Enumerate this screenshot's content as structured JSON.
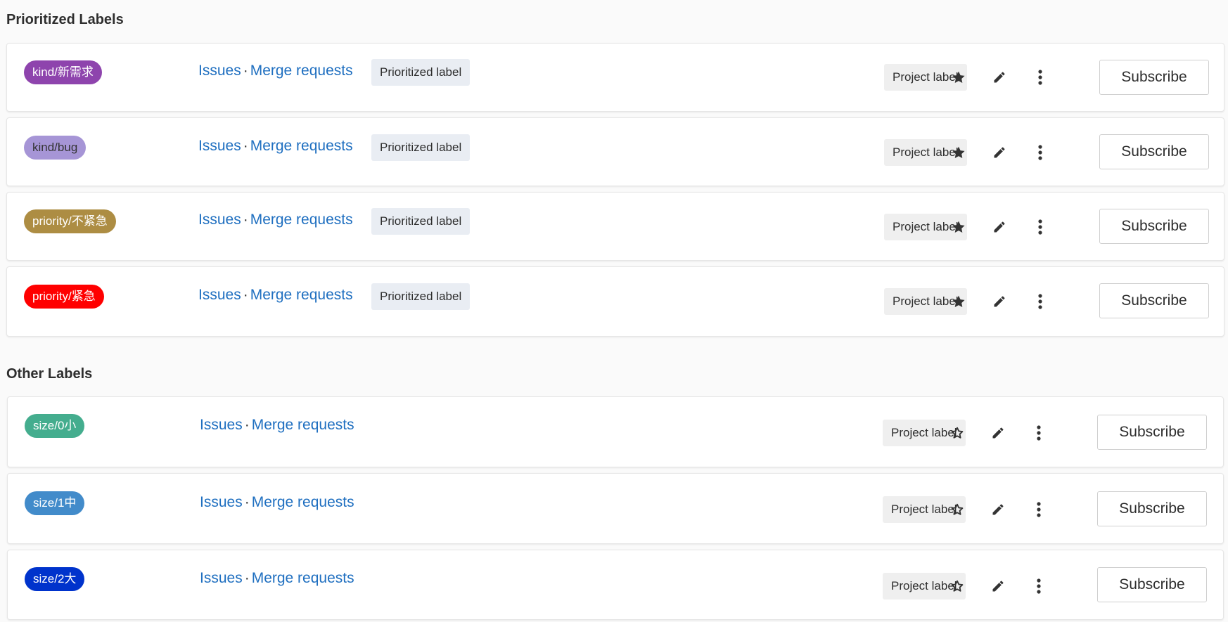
{
  "sections": {
    "prioritized_title": "Prioritized Labels",
    "other_title": "Other Labels"
  },
  "common": {
    "issues_link": "Issues",
    "separator": "·",
    "merge_requests_link": "Merge requests",
    "prioritized_badge": "Prioritized label",
    "project_badge": "Project label",
    "subscribe_label": "Subscribe"
  },
  "prioritized_labels": [
    {
      "name": "kind/新需求",
      "bg": "#8e44ad",
      "fg": "#ffffff",
      "starred": true
    },
    {
      "name": "kind/bug",
      "bg": "#a695d6",
      "fg": "#333333",
      "starred": true
    },
    {
      "name": "priority/不紧急",
      "bg": "#ad8d43",
      "fg": "#ffffff",
      "starred": true
    },
    {
      "name": "priority/紧急",
      "bg": "#ff0000",
      "fg": "#ffffff",
      "starred": true
    }
  ],
  "other_labels": [
    {
      "name": "size/0小",
      "bg": "#44ad8e",
      "fg": "#ffffff",
      "starred": false
    },
    {
      "name": "size/1中",
      "bg": "#428bca",
      "fg": "#ffffff",
      "starred": false
    },
    {
      "name": "size/2大",
      "bg": "#0033cc",
      "fg": "#ffffff",
      "starred": false
    }
  ],
  "icons": {
    "star": "star-icon",
    "star_outline": "star-outline-icon",
    "edit": "pencil-icon",
    "more": "more-vertical-icon"
  }
}
